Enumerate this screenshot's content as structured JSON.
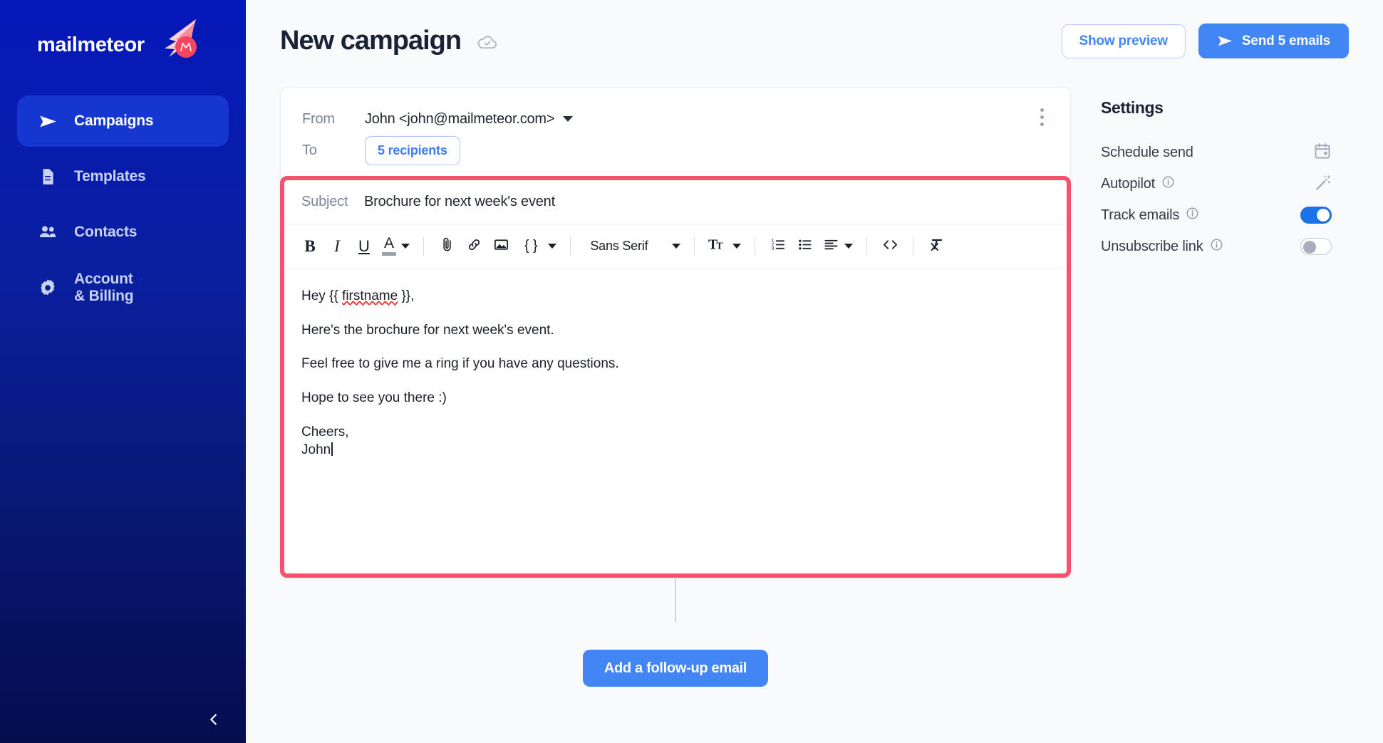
{
  "sidebar": {
    "brand": "mailmeteor",
    "items": [
      {
        "label": "Campaigns",
        "icon": "paper-plane-icon",
        "active": true
      },
      {
        "label": "Templates",
        "icon": "document-icon",
        "active": false
      },
      {
        "label": "Contacts",
        "icon": "people-icon",
        "active": false
      },
      {
        "label": "Account\n& Billing",
        "line1": "Account",
        "line2": "& Billing",
        "icon": "gear-icon",
        "active": false
      }
    ],
    "collapse_icon": "chevron-left-icon"
  },
  "header": {
    "title": "New campaign",
    "saved_icon": "cloud-check-icon",
    "show_preview_label": "Show preview",
    "send_label": "Send 5 emails",
    "send_icon": "paper-plane-icon"
  },
  "composer": {
    "from_label": "From",
    "from_value": "John <john@mailmeteor.com>",
    "to_label": "To",
    "recipients_chip": "5 recipients",
    "menu_icon": "kebab-menu-icon",
    "subject_label": "Subject",
    "subject_value": "Brochure for next week's event",
    "highlight_color": "#f5526e",
    "toolbar": {
      "bold": "B",
      "italic": "I",
      "underline": "U",
      "text_color": "A",
      "attach_icon": "paperclip-icon",
      "link_icon": "link-icon",
      "image_icon": "image-icon",
      "merge_tag": "{ }",
      "font_family": "Sans Serif",
      "font_size_icon": "font-size-icon",
      "numbered_list_icon": "numbered-list-icon",
      "bullet_list_icon": "bullet-list-icon",
      "align_icon": "align-left-icon",
      "code_icon": "code-icon",
      "clear_format_icon": "clear-formatting-icon"
    },
    "body": {
      "line1_pre": "Hey {{ ",
      "line1_tag": "firstname",
      "line1_post": " }},",
      "line2": "Here's the brochure for next week's event.",
      "line3": "Feel free to give me a ring if you have any questions.",
      "line4": "Hope to see you there :)",
      "line5": "Cheers,",
      "line6": "John"
    }
  },
  "followup": {
    "button_label": "Add a follow-up email"
  },
  "settings": {
    "title": "Settings",
    "rows": [
      {
        "label": "Schedule send",
        "info": false,
        "control": "icon",
        "icon": "calendar-icon"
      },
      {
        "label": "Autopilot",
        "info": true,
        "control": "icon",
        "icon": "magic-wand-icon"
      },
      {
        "label": "Track emails",
        "info": true,
        "control": "toggle",
        "state": "on"
      },
      {
        "label": "Unsubscribe link",
        "info": true,
        "control": "toggle",
        "state": "off"
      }
    ]
  },
  "colors": {
    "accent_blue": "#4285f4",
    "sidebar_top": "#0618bb",
    "sidebar_bottom": "#050d4e",
    "highlight": "#f5526e",
    "toggle_on": "#1a73e8"
  }
}
